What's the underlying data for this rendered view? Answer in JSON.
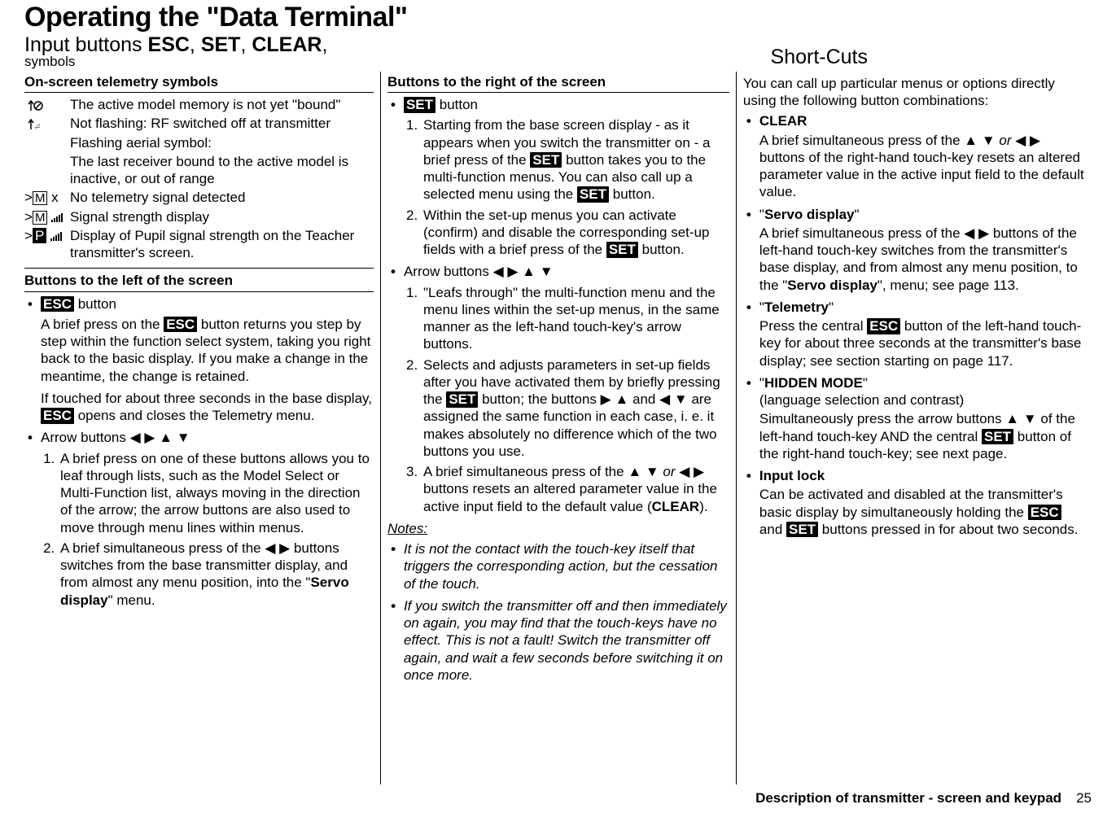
{
  "header": {
    "title": "Operating the \"Data Terminal\"",
    "subtitle_prefix": "Input buttons ",
    "subtitle_btns": [
      "ESC",
      "SET",
      "CLEAR"
    ],
    "subtitle_suffix": ",",
    "subtitle_small": "symbols",
    "shortcuts": "Short-Cuts"
  },
  "col1": {
    "sec1": {
      "head": "On-screen telemetry symbols",
      "rows": [
        {
          "icon": "antenna-slash",
          "text": "The active model memory is not yet \"bound\""
        },
        {
          "icon": "antenna-off",
          "text": "Not flashing: RF switched off at transmitter"
        },
        {
          "icon": "",
          "text": "Flashing aerial symbol:"
        },
        {
          "icon": "",
          "text": "The last receiver bound to the active model is inactive, or out of range"
        },
        {
          "icon": "mx",
          "text": "No telemetry signal detected"
        },
        {
          "icon": "mbars",
          "text": "Signal strength display"
        },
        {
          "icon": "pbars",
          "text": "Display of Pupil signal strength on the Teacher transmitter's screen."
        }
      ]
    },
    "sec2": {
      "head": "Buttons to the left of the screen",
      "esc_label": " button",
      "esc_btn": "ESC",
      "esc_p1a": "A brief press on the ",
      "esc_p1b": " button returns you step by step within the function select system, taking you right back to the basic display. If you make a change in the meantime, the change is retained.",
      "esc_p2a": "If touched for about three seconds in the base display, ",
      "esc_p2b": " opens and closes the Telemetry menu.",
      "arrow_label": "Arrow buttons ",
      "arrow_glyphs": "◀ ▶  ▲ ▼",
      "arrow_li1": "A brief press on one of these buttons allows you to leaf through lists, such as the Model Select or Multi-Function list, always moving in the direction of the arrow; the arrow buttons are also used to move through menu lines within menus.",
      "arrow_li2a": "A brief simultaneous press of the ",
      "arrow_li2b": " buttons switches from the base transmitter display, and from almost any menu position, into the \"",
      "arrow_li2c": "Servo display",
      "arrow_li2d": "\" menu.",
      "arrow_lr": "◀ ▶"
    }
  },
  "col2": {
    "head": "Buttons to the right of the screen",
    "set_btn": "SET",
    "set_label": " button",
    "set_li1a": "Starting from the base screen display - as it appears when you switch the transmitter on - a brief press of the ",
    "set_li1b": " button takes you to the multi-function menus. You can also call up a selected menu using the ",
    "set_li1c": " button.",
    "set_li2a": "Within the set-up menus you can activate (confirm) and disable the corresponding set-up fields with a brief press of the ",
    "set_li2b": " button.",
    "arrow_label": "Arrow buttons ",
    "arrow_glyphs": "◀ ▶  ▲ ▼",
    "ar_li1": "\"Leafs through\" the multi-function menu and the menu lines within the set-up menus, in the same manner as the left-hand touch-key's arrow buttons.",
    "ar_li2a": "Selects and adjusts parameters in set-up fields after you have activated them by briefly pressing the ",
    "ar_li2b": " button; the buttons ",
    "ar_li2c": " and ",
    "ar_li2d": " are assigned the same function in each case, i. e. it makes absolutely no difference which of the two buttons you use.",
    "ar_ru": "▶ ▲",
    "ar_ld": "◀ ▼",
    "ar_li3a": "A brief simultaneous press of the ",
    "ar_li3b": " or ",
    "ar_li3c": " buttons resets an altered parameter value in the active input field to the default value (",
    "ar_li3d": ").",
    "clear": "CLEAR",
    "ar_ud": "▲ ▼",
    "ar_lr": "◀ ▶",
    "notes_head": "Notes:",
    "note1": "It is not the contact with the touch-key itself that triggers the corresponding action, but the cessation of the touch.",
    "note2": "If you switch the transmitter off and then immediately on again, you may find that the touch-keys have no effect. This is not a fault! Switch the transmitter off again, and wait a few seconds before switching it on once more."
  },
  "col3": {
    "intro": "You can call up particular menus or options directly using the following button combinations:",
    "clear_head": "CLEAR",
    "clear_body_a": "A brief simultaneous press of the ",
    "clear_body_b": " or ",
    "clear_body_c": " buttons of the right-hand touch-key resets an altered parameter value in the active input field to the default value.",
    "ar_ud": "▲ ▼",
    "ar_lr": "◀ ▶",
    "servo_head_a": "\"",
    "servo_head_b": "Servo display",
    "servo_head_c": "\"",
    "servo_body_a": "A brief simultaneous press of the ",
    "servo_body_b": " buttons of the left-hand touch-key switches from the transmitter's base display, and from almost any menu position, to the \"",
    "servo_body_c": "Servo display",
    "servo_body_d": "\", menu; see page 113.",
    "tel_head": "Telemetry",
    "tel_body_a": "Press the central ",
    "tel_body_b": " button of the left-hand touch-key for about three seconds at the transmitter's base display; see section starting on page 117.",
    "esc": "ESC",
    "hm_head": "HIDDEN MODE",
    "hm_sub": "(language selection and contrast)",
    "hm_body_a": "Simultaneously press the arrow buttons ",
    "hm_body_b": " of the left-hand touch-key AND the central ",
    "hm_body_c": " button of the right-hand touch-key; see next page.",
    "set": "SET",
    "il_head": "Input lock",
    "il_body_a": "Can be activated and disabled at the transmitter's basic display by simultaneously holding the ",
    "il_body_b": " and ",
    "il_body_c": " buttons pressed in for about two seconds."
  },
  "footer": {
    "label": "Description of transmitter - screen and keypad",
    "page": "25"
  }
}
